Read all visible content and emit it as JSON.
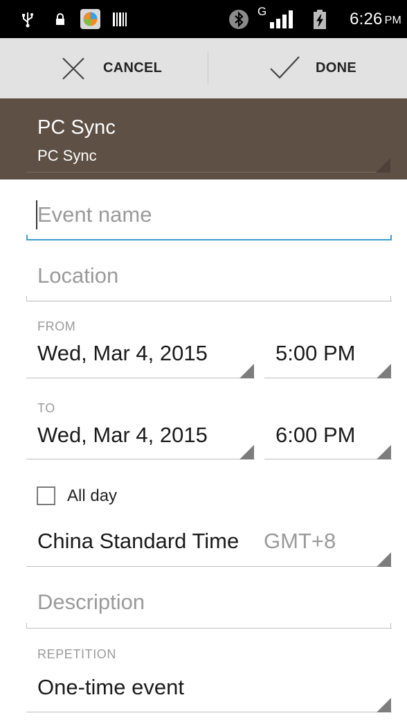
{
  "status_bar": {
    "time": "6:26",
    "ampm": "PM",
    "network": "G",
    "icons": [
      "usb-icon",
      "lock-icon",
      "app-icon",
      "barcode-icon",
      "bluetooth-icon",
      "signal-icon",
      "battery-charging-icon"
    ]
  },
  "action_bar": {
    "cancel_label": "CANCEL",
    "done_label": "DONE"
  },
  "account": {
    "name": "PC Sync",
    "subtitle": "PC Sync",
    "color": "#5e5045"
  },
  "form": {
    "event_name_placeholder": "Event name",
    "location_placeholder": "Location",
    "from": {
      "caption": "FROM",
      "date": "Wed, Mar 4, 2015",
      "time": "5:00 PM"
    },
    "to": {
      "caption": "TO",
      "date": "Wed, Mar 4, 2015",
      "time": "6:00 PM"
    },
    "all_day": {
      "label": "All day",
      "checked": false
    },
    "timezone": {
      "name": "China Standard Time",
      "offset": "GMT+8"
    },
    "description_placeholder": "Description",
    "repetition": {
      "caption": "REPETITION",
      "value": "One-time event"
    }
  },
  "colors": {
    "accent": "#3c9ed0",
    "status_bar": "#000000",
    "action_bar": "#e2e2e2"
  }
}
